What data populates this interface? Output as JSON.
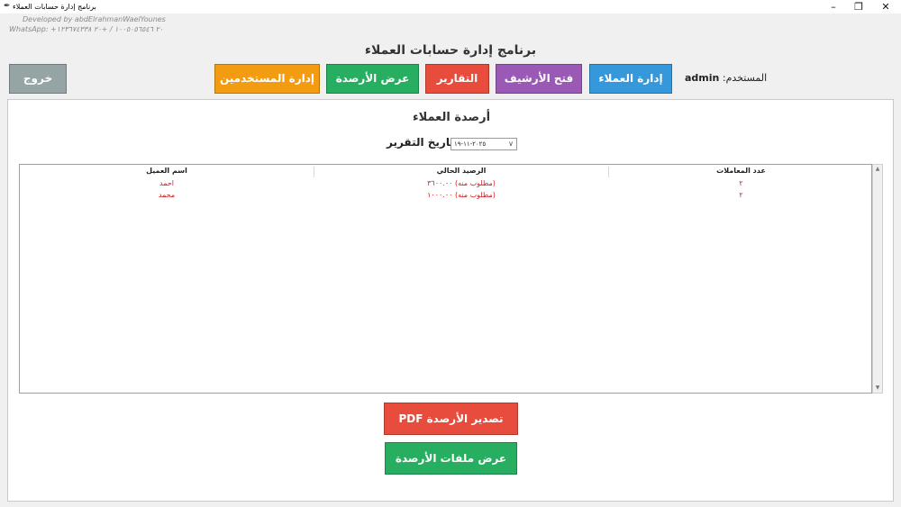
{
  "window": {
    "title": "برنامج إدارة حسابات العملاء",
    "minimize": "–",
    "restore": "❐",
    "close": "✕"
  },
  "developer": {
    "line1": "Developed by abdElrahmanWaelYounes",
    "line2": "WhatsApp: +٢٠ ١٠٠٥٠٥٦٥٤٦ / +٢٠ ١٢٣٦٧٤٣٣٨"
  },
  "app_title": "برنامج إدارة حسابات العملاء",
  "user": {
    "label": ":المستخدم",
    "name": "admin"
  },
  "nav": {
    "customers": "إدارة العملاء",
    "archive": "فتح الأرشيف",
    "reports": "التقارير",
    "balances": "عرض الأرصدة",
    "users": "إدارة المستخدمين",
    "exit": "خروج"
  },
  "report": {
    "title": "أرصدة العملاء",
    "date_label": ":تاريخ التقرير",
    "date_value": "٢٠٢٥-١١-١٩"
  },
  "table": {
    "headers": [
      "اسم العميل",
      "الرصيد الحالي",
      "عدد المعاملات"
    ],
    "rows": [
      [
        "احمد",
        "(مطلوب منه) ٣٦٠٠.٠٠",
        "٢"
      ],
      [
        "محمد",
        "(مطلوب منه) ١٠٠٠.٠٠",
        "٢"
      ]
    ]
  },
  "actions": {
    "export_pdf": "تصدير الأرصدة PDF",
    "view_files": "عرض ملفات الأرصدة"
  },
  "colors": {
    "blue": "#3498db",
    "purple": "#9b59b6",
    "red": "#e74c3c",
    "green": "#27ae60",
    "orange": "#f39c12",
    "gray": "#95a5a6",
    "debt_text": "#d0201e"
  }
}
